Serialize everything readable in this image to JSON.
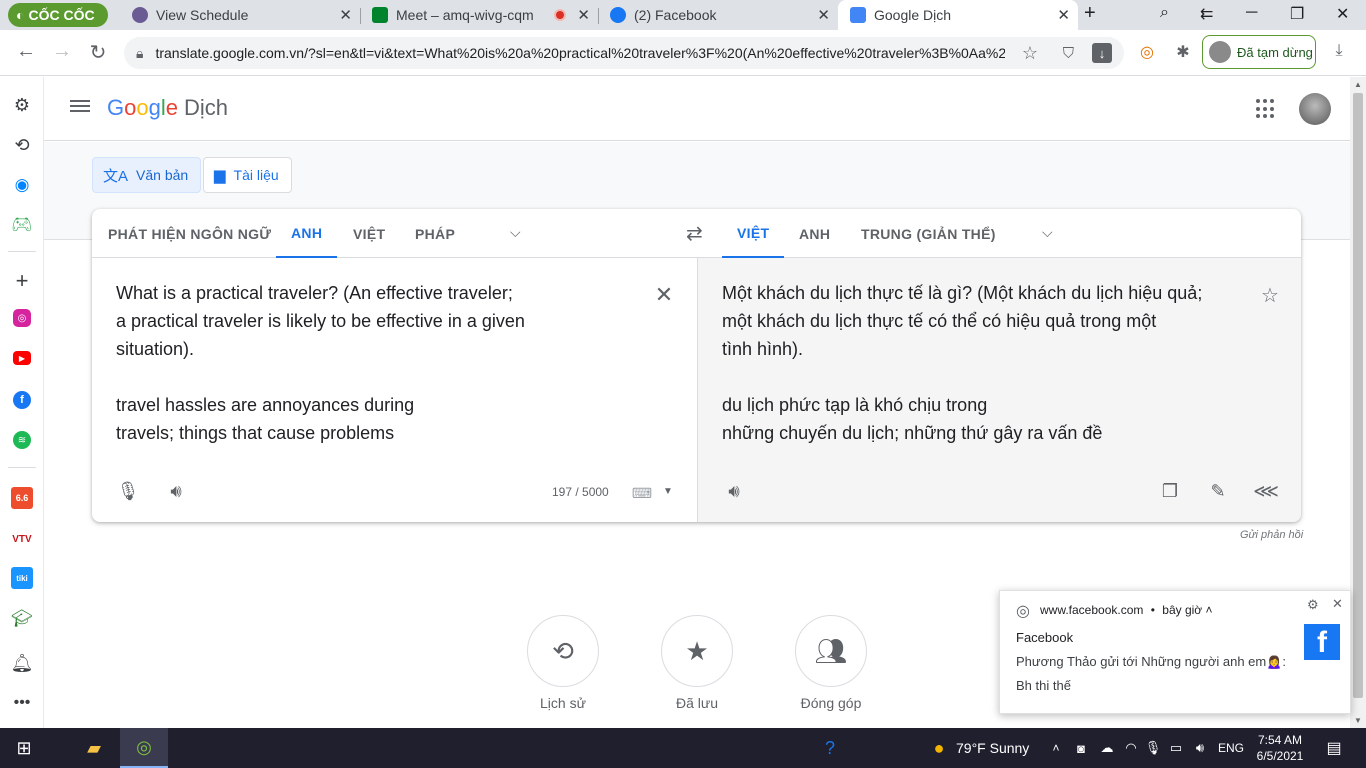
{
  "browser": {
    "brand": "CỐC CỐC",
    "tabs": [
      {
        "title": "View Schedule",
        "icon": "globe-icon"
      },
      {
        "title": "Meet – amq-wivg-cqm",
        "icon": "meet-icon"
      },
      {
        "title": "(2) Facebook",
        "icon": "facebook-icon"
      },
      {
        "title": "Google Dịch",
        "icon": "google-translate-icon"
      }
    ],
    "url": "translate.google.com.vn/?sl=en&tl=vi&text=What%20is%20a%20practical%20traveler%3F%20(An%20effective%20traveler%3B%0Aa%2...",
    "profile_status": "Đã tạm dừng"
  },
  "app": {
    "brand_parts": [
      "G",
      "o",
      "o",
      "g",
      "l",
      "e"
    ],
    "brand_suffix": "Dịch",
    "modes": [
      {
        "label": "Văn bản",
        "icon": "translate-icon"
      },
      {
        "label": "Tài liệu",
        "icon": "document-icon"
      }
    ],
    "source_langs": [
      "PHÁT HIỆN NGÔN NGỮ",
      "ANH",
      "VIỆT",
      "PHÁP"
    ],
    "target_langs": [
      "VIỆT",
      "ANH",
      "TRUNG (GIẢN THỂ)"
    ],
    "source_text": "What is a practical traveler? (An effective traveler;\na practical traveler is likely to be effective in a given\nsituation).\n\ntravel hassles are annoyances during\ntravels; things that cause problems",
    "target_text": "Một khách du lịch thực tế là gì? (Một khách du lịch hiệu quả;\nmột khách du lịch thực tế có thể có hiệu quả trong một\ntình hình).\n\ndu lịch phức tạp là khó chịu trong\nnhững chuyến du lịch; những thứ gây ra vấn đề",
    "char_count": "197 / 5000",
    "feedback": "Gửi phản hồi",
    "bottom_actions": [
      {
        "label": "Lịch sử",
        "icon": "history-icon"
      },
      {
        "label": "Đã lưu",
        "icon": "star-icon"
      },
      {
        "label": "Đóng góp",
        "icon": "contribute-icon"
      }
    ]
  },
  "notification": {
    "site": "www.facebook.com",
    "time": "bây giờ",
    "title": "Facebook",
    "body": "Phương Thảo gửi tới Những người anh em🙍‍♀️:",
    "body2": "Bh thi thế"
  },
  "taskbar": {
    "weather": "79°F  Sunny",
    "lang": "ENG",
    "time": "7:54 AM",
    "date": "6/5/2021"
  }
}
